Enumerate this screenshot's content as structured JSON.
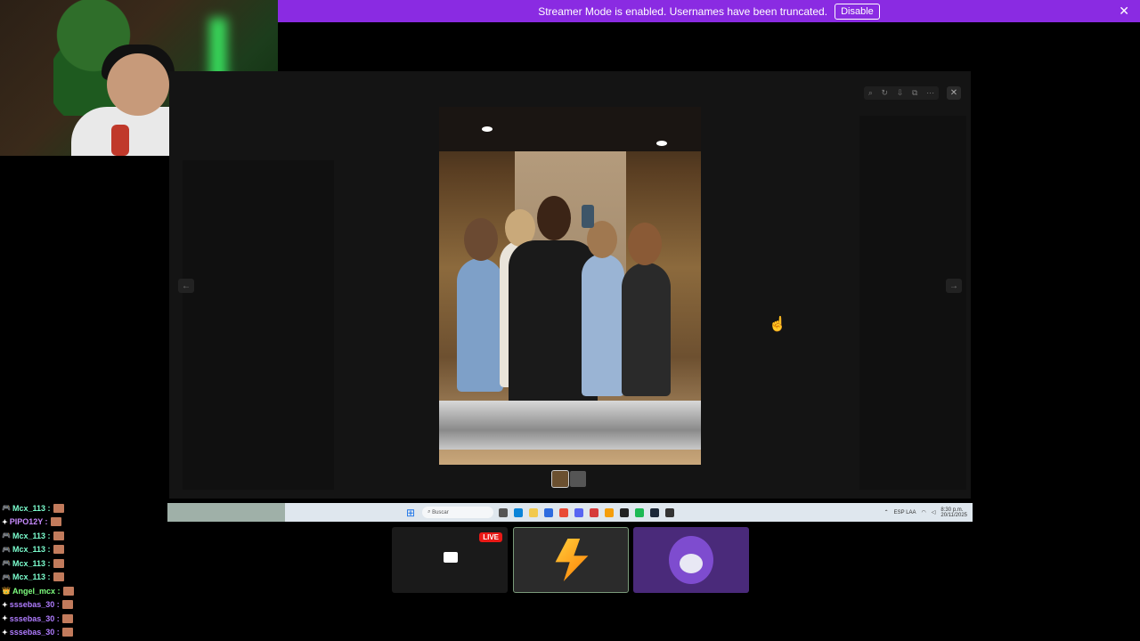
{
  "banner": {
    "message": "Streamer Mode is enabled. Usernames have been truncated.",
    "disable_label": "Disable",
    "close_glyph": "✕"
  },
  "viewer": {
    "close_glyph": "✕",
    "prev_glyph": "←",
    "next_glyph": "→",
    "toolbar_icons": [
      "zoom-icon",
      "rotate-icon",
      "download-icon",
      "external-link-icon",
      "more-icon"
    ]
  },
  "taskbar": {
    "search_placeholder": "Buscar",
    "tray_lang": "ESP LAA",
    "tray_time": "8:30 p.m.",
    "tray_date": "20/11/2025"
  },
  "tiles": {
    "live_label": "LIVE"
  },
  "chat": {
    "messages": [
      {
        "user": "Mcx_113 :",
        "color": "#7cffcf",
        "badge": "🎮"
      },
      {
        "user": "PIPO12Y :",
        "color": "#c88cff",
        "badge": "✦"
      },
      {
        "user": "Mcx_113 :",
        "color": "#7cffcf",
        "badge": "🎮"
      },
      {
        "user": "Mcx_113 :",
        "color": "#7cffcf",
        "badge": "🎮"
      },
      {
        "user": "Mcx_113 :",
        "color": "#7cffcf",
        "badge": "🎮"
      },
      {
        "user": "Mcx_113 :",
        "color": "#7cffcf",
        "badge": "🎮"
      },
      {
        "user": "Angel_mcx :",
        "color": "#7fff7f",
        "badge": "👑"
      },
      {
        "user": "sssebas_30 :",
        "color": "#b07cff",
        "badge": "✦"
      },
      {
        "user": "sssebas_30 :",
        "color": "#b07cff",
        "badge": "✦"
      },
      {
        "user": "sssebas_30 :",
        "color": "#b07cff",
        "badge": "✦"
      }
    ]
  },
  "colors": {
    "banner": "#8a2be2",
    "live": "#e91916"
  }
}
